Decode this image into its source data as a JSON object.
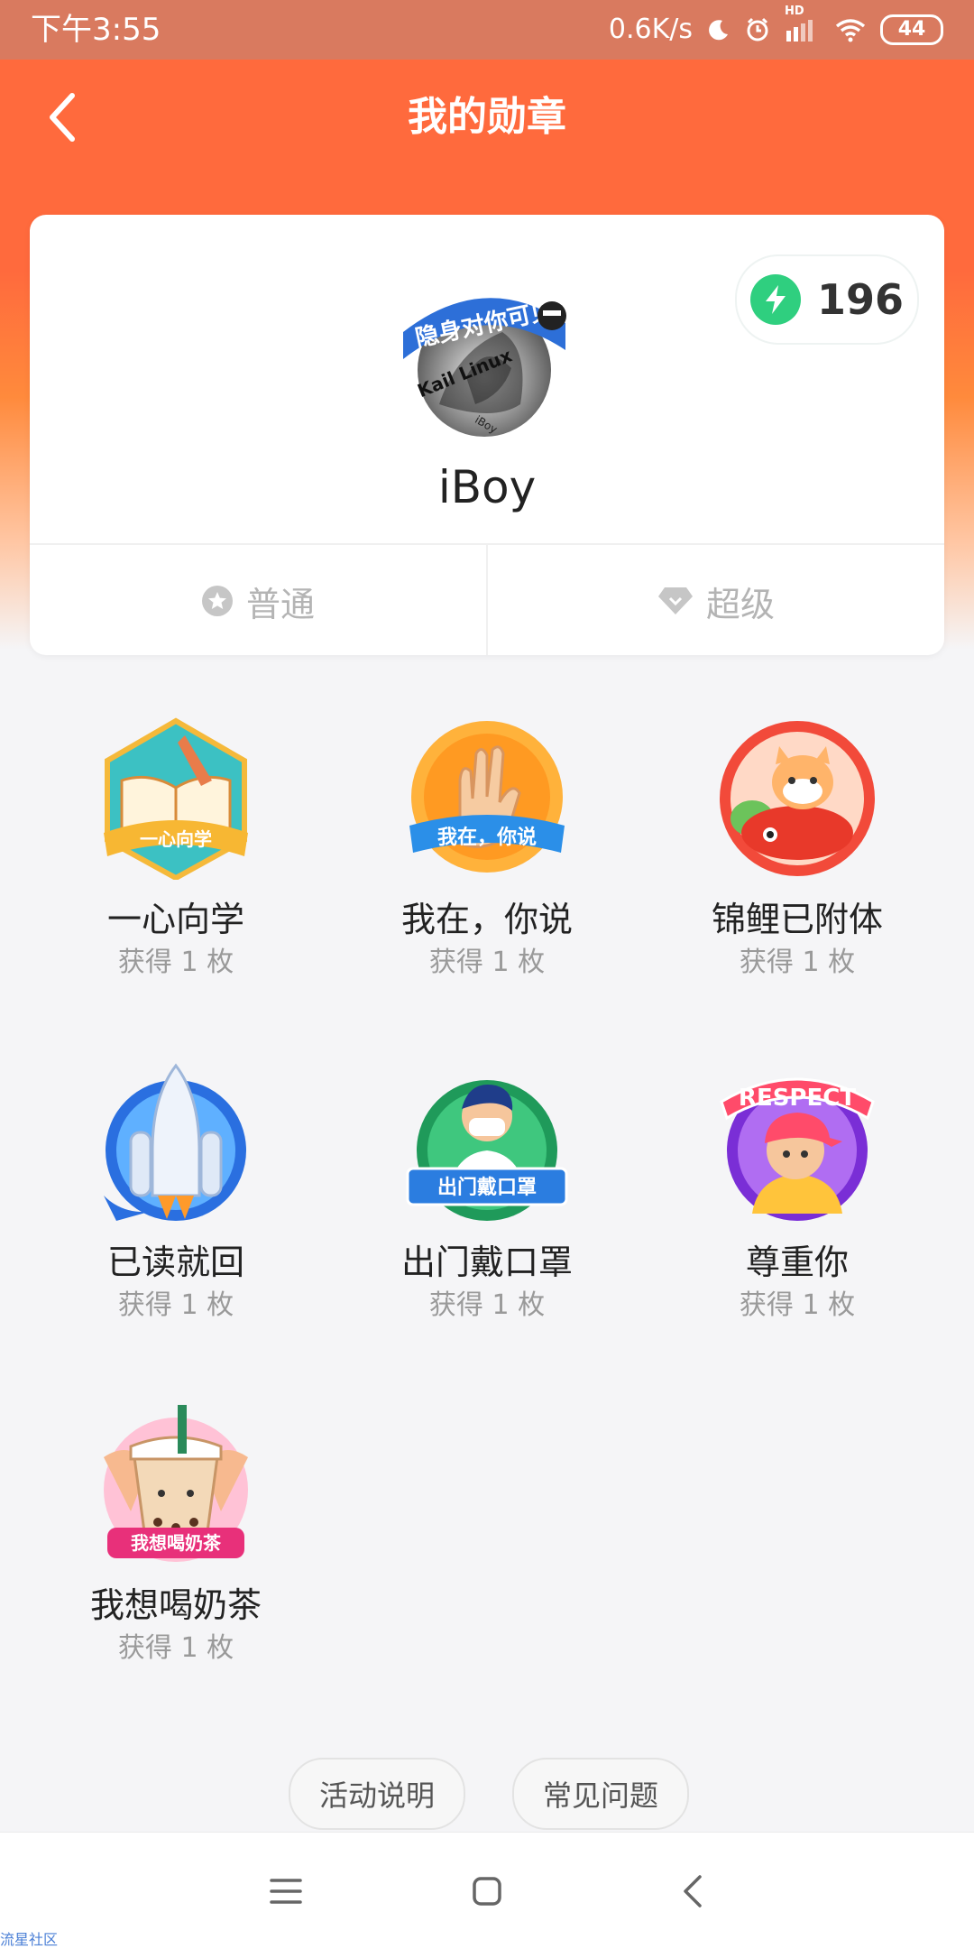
{
  "status_bar": {
    "time": "下午3:55",
    "speed": "0.6K/s",
    "signal_label": "HD",
    "battery": "44",
    "icons": [
      "moon-icon",
      "alarm-icon",
      "signal-icon",
      "wifi-icon",
      "battery-icon"
    ]
  },
  "header": {
    "title": "我的勋章",
    "back_icon": "chevron-left-icon"
  },
  "profile": {
    "avatar_text": [
      "隐身对你可见",
      "Kail Linux",
      "iBoy"
    ],
    "username": "iBoy",
    "points": "196",
    "points_icon": "lightning-icon"
  },
  "tabs": [
    {
      "label": "普通",
      "icon": "star-circle-icon"
    },
    {
      "label": "超级",
      "icon": "diamond-icon"
    }
  ],
  "medals": [
    {
      "name": "一心向学",
      "count": "获得 1 枚",
      "ribbon": "一心向学"
    },
    {
      "name": "我在，你说",
      "count": "获得 1 枚",
      "ribbon": "我在，你说"
    },
    {
      "name": "锦鲤已附体",
      "count": "获得 1 枚"
    },
    {
      "name": "已读就回",
      "count": "获得 1 枚"
    },
    {
      "name": "出门戴口罩",
      "count": "获得 1 枚",
      "ribbon": "出门戴口罩"
    },
    {
      "name": "尊重你",
      "count": "获得 1 枚",
      "ribbon": "RESPECT"
    },
    {
      "name": "我想喝奶茶",
      "count": "获得 1 枚",
      "ribbon": "我想喝奶茶"
    }
  ],
  "footer_links": {
    "activity": "活动说明",
    "faq": "常见问题"
  },
  "system_nav": {
    "icons": [
      "menu-icon",
      "home-icon",
      "back-icon"
    ]
  },
  "watermark": "流星社区",
  "colors": {
    "header_orange": "#ff6a3d",
    "status_bar": "#d97a5f",
    "points_green": "#2fcf7f"
  }
}
